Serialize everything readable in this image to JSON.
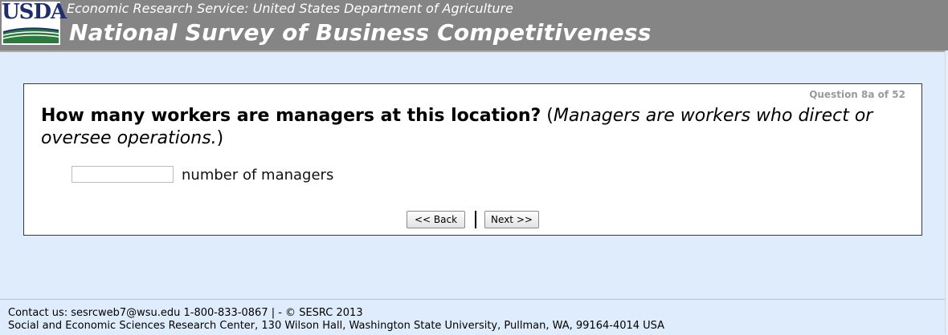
{
  "header": {
    "logo_text": "USDA",
    "agency": "Economic Research Service: United States Department of Agriculture",
    "title": "National Survey of Business Competitiveness"
  },
  "question": {
    "counter": "Question 8a of 52",
    "main_text": "How many workers are managers at this location?",
    "note_open": " (",
    "note_text": "Managers are workers who direct or oversee operations.",
    "note_close": ")",
    "input_value": "",
    "input_label": "number of managers"
  },
  "navigation": {
    "back_label": "<< Back",
    "next_label": "Next >>"
  },
  "footer": {
    "line1": "Contact us: sesrcweb7@wsu.edu 1-800-833-0867 | - © SESRC 2013",
    "line2": "Social and Economic Sciences Research Center, 130 Wilson Hall, Washington State University, Pullman, WA, 99164-4014 USA"
  },
  "colors": {
    "header_bg": "#858585",
    "page_bg": "#dfecfb",
    "logo_blue": "#1d2d6e",
    "logo_green": "#2a7a3b"
  }
}
